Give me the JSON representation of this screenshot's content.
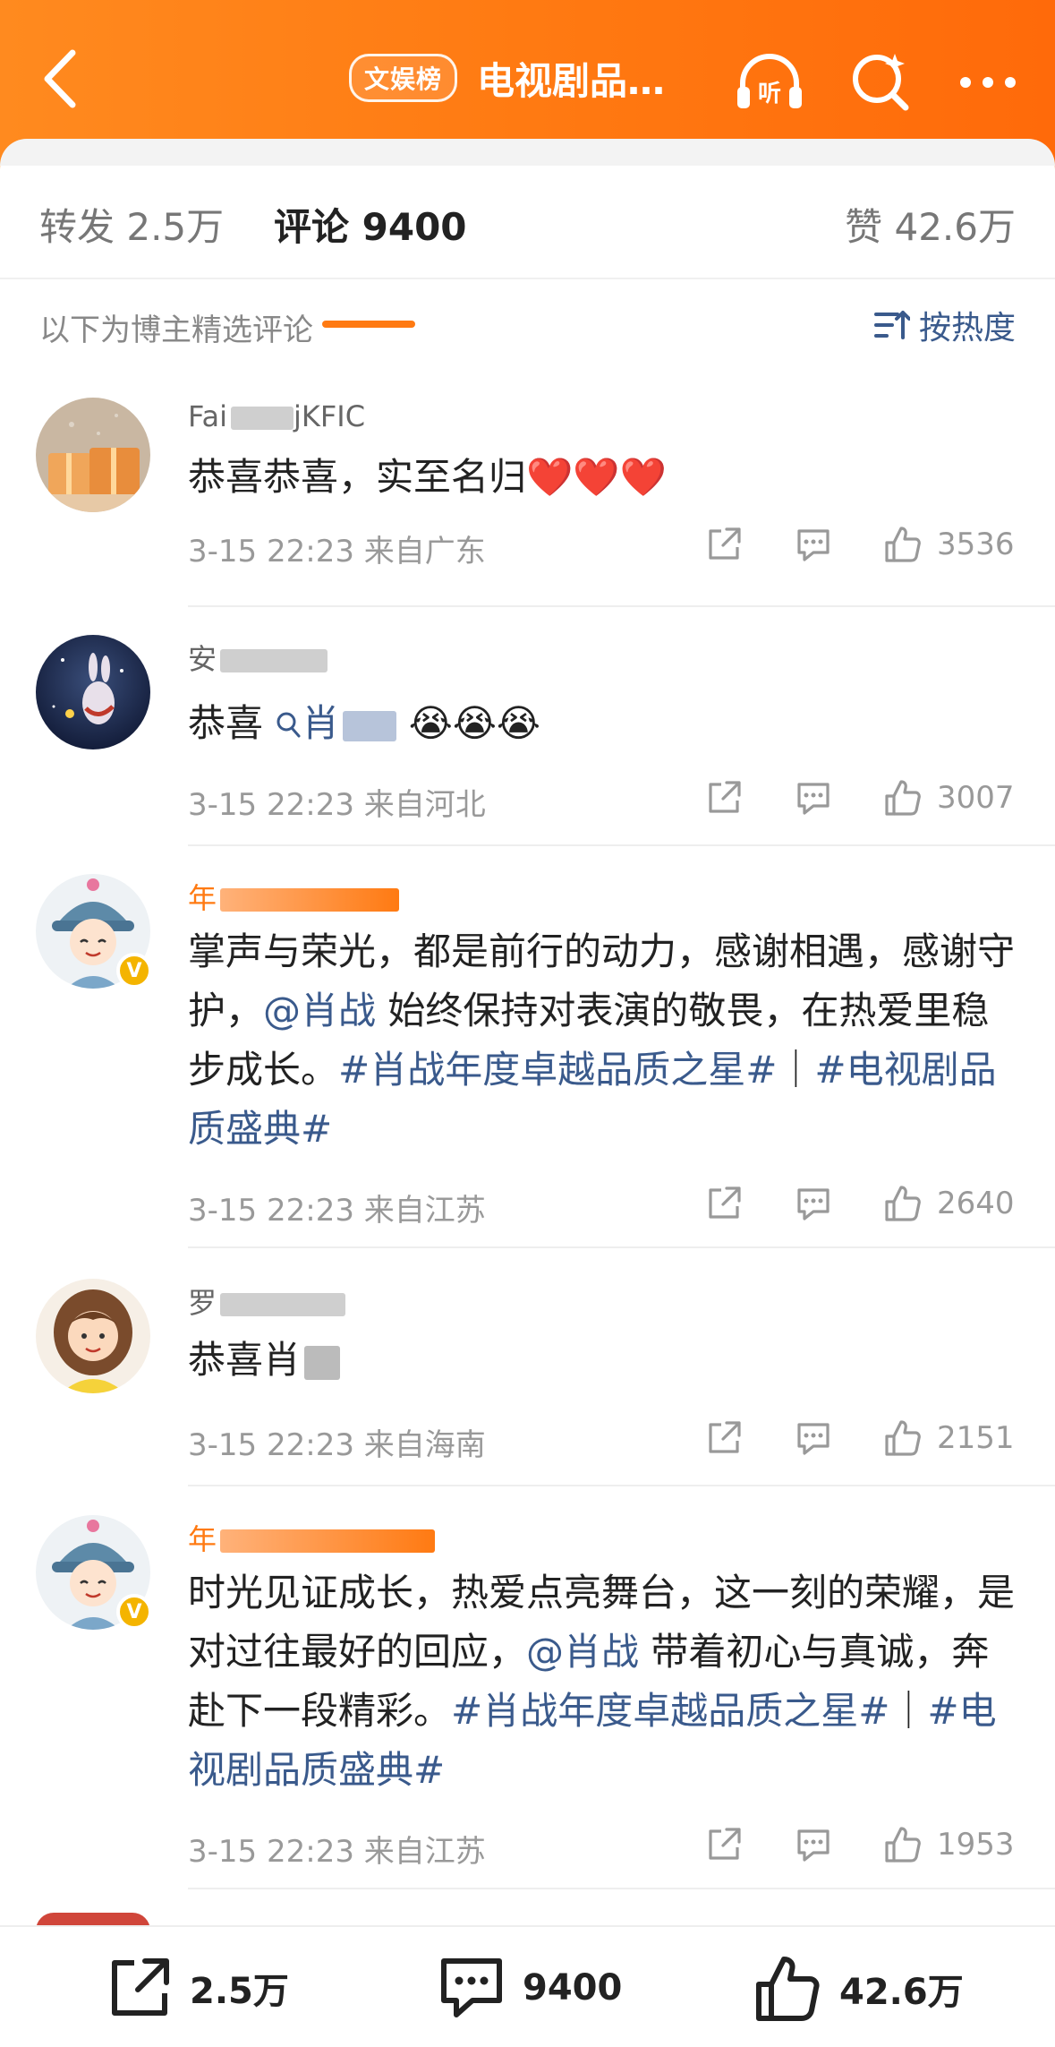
{
  "header": {
    "badge": "文娱榜",
    "title": "电视剧品…",
    "colors": {
      "accent": "#ff7a12",
      "link": "#3a5a8c"
    },
    "icons": [
      "back-icon",
      "listen-icon",
      "ai-search-icon",
      "more-icon"
    ],
    "listen_label": "听"
  },
  "tabs": {
    "forward": "转发 2.5万",
    "comment": "评论 9400",
    "like": "赞 42.6万"
  },
  "sub": {
    "label": "以下为博主精选评论",
    "sort": "按热度"
  },
  "comments": [
    {
      "username": "Fai",
      "username_tail": "jKFIC",
      "text": "恭喜恭喜，实至名归",
      "hearts": "❤️❤️❤️",
      "time": "3-15 22:23 来自广东",
      "likes": "3536"
    },
    {
      "username": "安",
      "text_before": "恭喜",
      "mention": "肖",
      "emojis": "😭😭😭",
      "time": "3-15 22:23 来自河北",
      "likes": "3007"
    },
    {
      "username": "年",
      "text_a": "掌声与荣光，都是前行的动力，感谢相遇，感谢守护，",
      "mention": "@肖战",
      "text_b": " 始终保持对表演的敬畏，在热爱里稳步成长。",
      "topic1": "#肖战年度卓越品质之星#",
      "sep": "｜",
      "topic2": "#电视剧品质盛典#",
      "time": "3-15 22:23 来自江苏",
      "likes": "2640"
    },
    {
      "username": "罗",
      "text": "恭喜肖",
      "time": "3-15 22:23 来自海南",
      "likes": "2151"
    },
    {
      "username": "年",
      "text_a": "时光见证成长，热爱点亮舞台，这一刻的荣耀，是对过往最好的回应，",
      "mention": "@肖战",
      "text_b": " 带着初心与真诚，奔赴下一段精彩。",
      "topic1": "#肖战年度卓越品质之星#",
      "sep": "｜",
      "topic2": "#电视剧品质盛典#",
      "time": "3-15 22:23 来自江苏",
      "likes": "1953"
    }
  ],
  "bottom": {
    "share": "2.5万",
    "comment": "9400",
    "like": "42.6万"
  }
}
